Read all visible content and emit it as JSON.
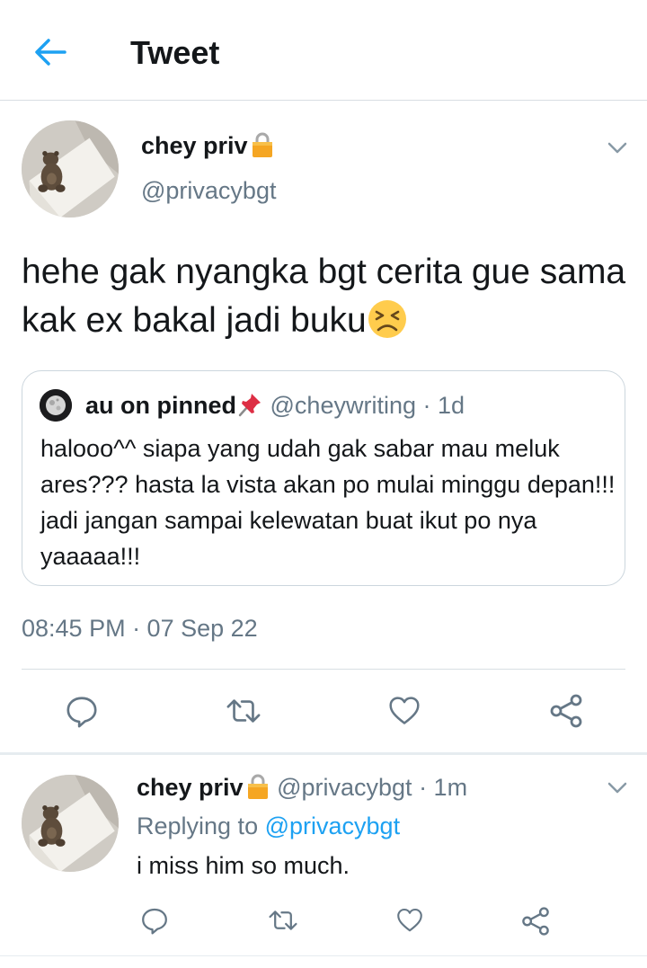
{
  "header": {
    "title": "Tweet"
  },
  "tweet": {
    "display_name": "chey priv",
    "handle": "@privacybgt",
    "text": "hehe gak nyangka bgt cerita gue sama kak ex bakal jadi buku",
    "timestamp": "08:45 PM · 07 Sep 22",
    "quoted": {
      "display_name": "au on pinned",
      "handle": "@cheywriting",
      "time": "· 1d",
      "text": "halooo^^ siapa yang udah gak sabar mau meluk ares??? hasta la vista akan po mulai minggu depan!!! jadi jangan sampai kelewatan buat ikut po nya yaaaaa!!!"
    }
  },
  "reply": {
    "display_name": "chey priv",
    "handle": "@privacybgt",
    "time": "· 1m",
    "replying_prefix": "Replying to",
    "replying_to": "@privacybgt",
    "text": "i miss him so much."
  },
  "colors": {
    "accent": "#1da1f2",
    "secondary_text": "#657786",
    "divider": "#d8dee3"
  },
  "icons": [
    "back-arrow-icon",
    "chevron-down-icon",
    "lock-icon",
    "tired-face-emoji",
    "pushpin-emoji",
    "reply-icon",
    "retweet-icon",
    "like-icon",
    "share-icon"
  ]
}
